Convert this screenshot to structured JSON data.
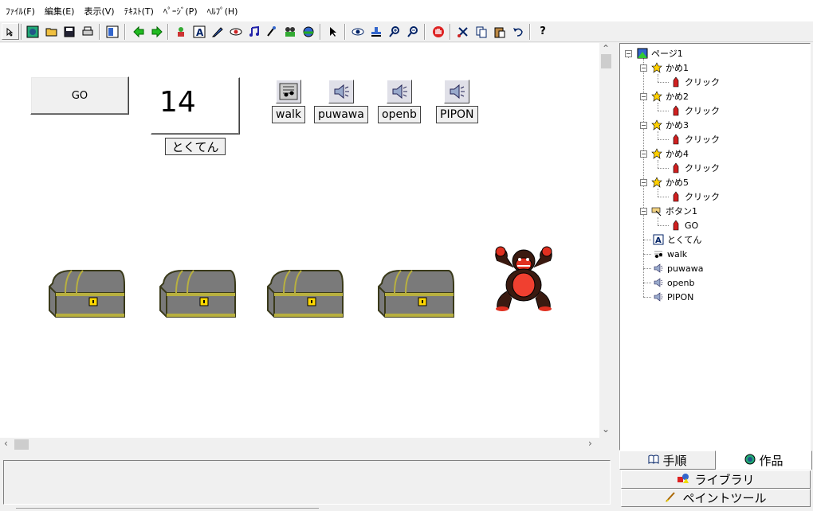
{
  "menu": [
    "ﾌｧｲﾙ(F)",
    "編集(E)",
    "表示(V)",
    "ﾃｷｽﾄ(T)",
    "ﾍﾟｰｼﾞ(P)",
    "ﾍﾙﾌﾟ(H)"
  ],
  "canvas": {
    "go_button": "GO",
    "score_value": "14",
    "score_label": "とくてん",
    "sounds": [
      "walk",
      "puwawa",
      "openb",
      "PIPON"
    ]
  },
  "tree": {
    "root": "ページ1",
    "kame1": "かめ1",
    "kame2": "かめ2",
    "kame3": "かめ3",
    "kame4": "かめ4",
    "kame5": "かめ5",
    "click": "クリック",
    "button1": "ボタン1",
    "go": "GO",
    "tokuten": "とくてん",
    "walk": "walk",
    "puwawa": "puwawa",
    "openb": "openb",
    "pipon": "PIPON"
  },
  "tabs": {
    "steps": "手順",
    "work": "作品"
  },
  "buttons": {
    "library": "ライブラリ",
    "paint_tool": "ペイントツール"
  }
}
